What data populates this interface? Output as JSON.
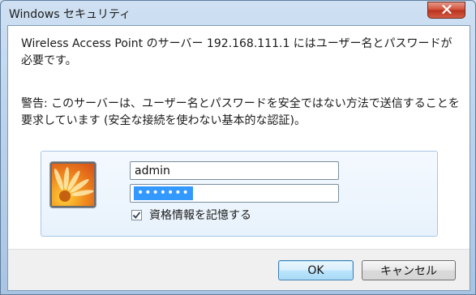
{
  "window": {
    "title": "Windows セキュリティ",
    "close_icon": "close-icon"
  },
  "dialog": {
    "message": "Wireless Access Point のサーバー 192.168.111.1 にはユーザー名とパスワードが必要です。",
    "warning": "警告: このサーバーは、ユーザー名とパスワードを安全ではない方法で送信することを要求しています (安全な接続を使わない基本的な認証)。"
  },
  "credentials": {
    "avatar_icon": "user-avatar-flower-icon",
    "username": "admin",
    "password_mask": "•••••••",
    "remember_checked": true,
    "remember_label": "資格情報を記憶する"
  },
  "buttons": {
    "ok": "OK",
    "cancel": "キャンセル"
  }
}
